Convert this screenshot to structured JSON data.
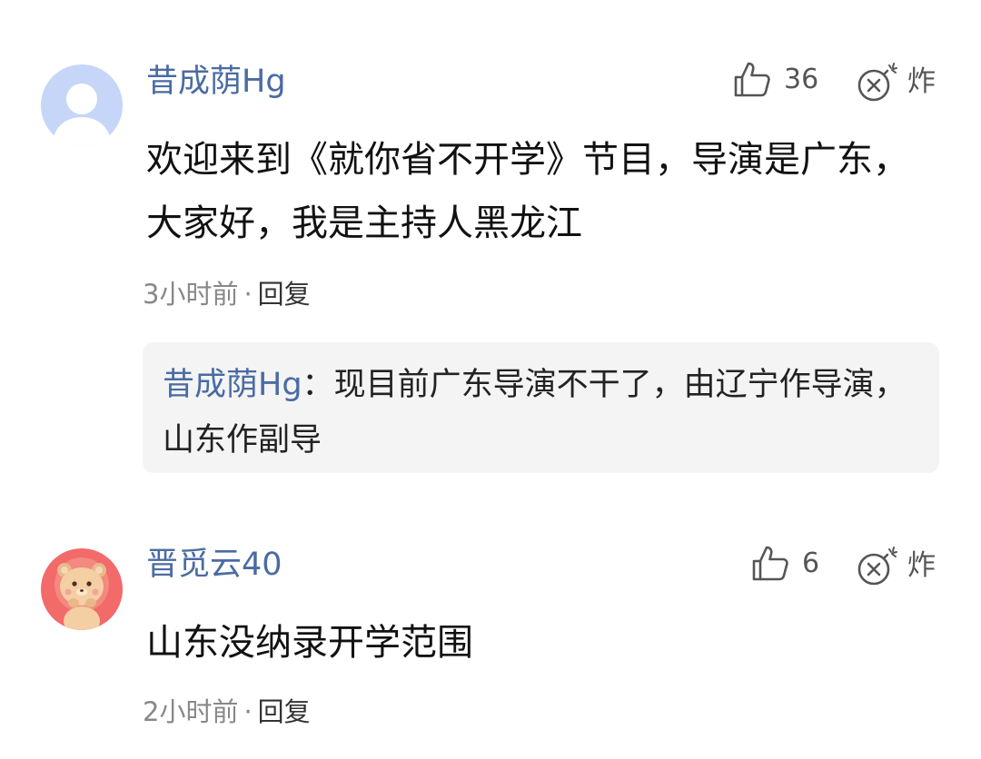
{
  "comments": [
    {
      "username": "昔成荫Hg",
      "like_count": "36",
      "bomb_label": "炸",
      "content": "欢迎来到《就你省不开学》节目，导演是广东，大家好，我是主持人黑龙江",
      "time": "3小时前",
      "separator": "·",
      "reply_label": "回复",
      "avatar": "default-avatar-icon",
      "replies": [
        {
          "author": "昔成荫Hg",
          "colon": "：",
          "text": "现目前广东导演不干了，由辽宁作导演，山东作副导"
        }
      ]
    },
    {
      "username": "晋觅云40",
      "like_count": "6",
      "bomb_label": "炸",
      "content": "山东没纳录开学范围",
      "time": "2小时前",
      "separator": "·",
      "reply_label": "回复",
      "avatar": "cartoon-bear-avatar"
    }
  ],
  "colors": {
    "username": "#4a6ba3",
    "body_text": "#111111",
    "meta_text": "#888888",
    "reply_bg": "#f4f4f4",
    "avatar_default_bg": "#c6d6f8",
    "avatar_bear_bg": "#f26a6a"
  }
}
